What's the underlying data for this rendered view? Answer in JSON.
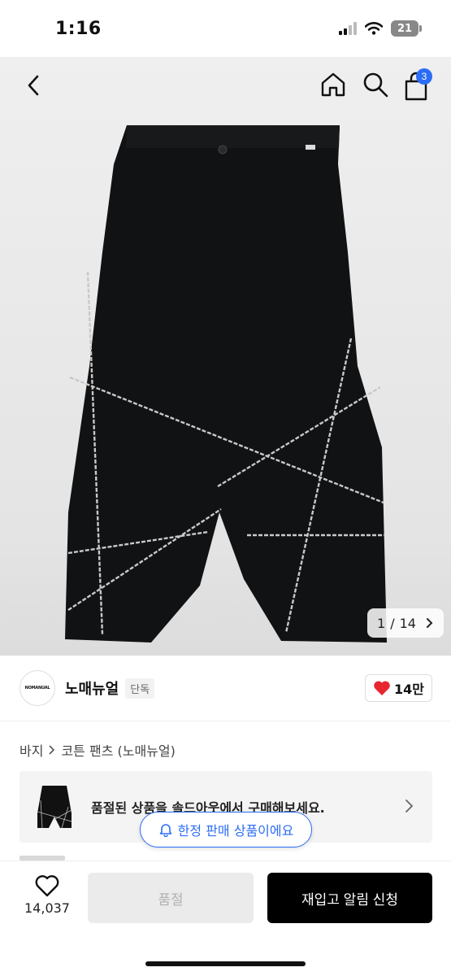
{
  "status_bar": {
    "time": "1:16",
    "battery": "21"
  },
  "nav": {
    "cart_count": "3"
  },
  "gallery": {
    "current": "1",
    "separator": "/",
    "total": "14"
  },
  "brand": {
    "logo_text": "NOMANUAL",
    "name": "노매뉴얼",
    "tag": "단독",
    "likes": "14만"
  },
  "breadcrumb": {
    "category": "바지",
    "product": "코튼 팬츠 (노매뉴얼)"
  },
  "soldout_banner": {
    "text": "품절된 상품을 솔드아웃에서 구매해보세요."
  },
  "limited_pill": {
    "text": "한정 판매 상품이에요"
  },
  "bottom_bar": {
    "wish_count": "14,037",
    "soldout_label": "품절",
    "restock_label": "재입고 알림 신청"
  },
  "colors": {
    "accent": "#2c6df5",
    "heart": "#e8262f",
    "primary_button": "#000000"
  }
}
